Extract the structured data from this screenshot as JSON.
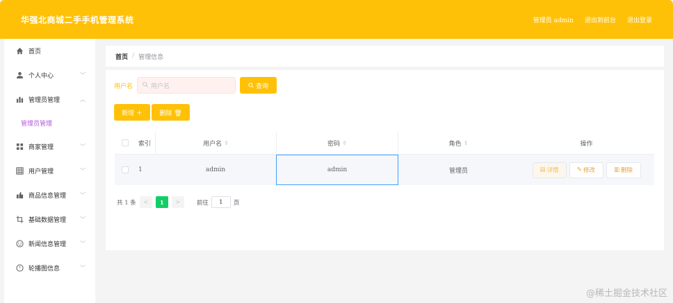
{
  "header": {
    "title": "华强北商城二手手机管理系统",
    "admin_label": "管理员 admin",
    "back_label": "退出到前台",
    "logout_label": "退出登录",
    "bg_color": "#ffc107"
  },
  "sidebar": {
    "items": [
      {
        "label": "首页",
        "icon": "home-icon"
      },
      {
        "label": "个人中心",
        "icon": "user-icon"
      },
      {
        "label": "管理员管理",
        "icon": "chart-icon"
      },
      {
        "label": "商家管理",
        "icon": "grid-icon"
      },
      {
        "label": "用户管理",
        "icon": "table-icon"
      },
      {
        "label": "商品信息管理",
        "icon": "goods-icon"
      },
      {
        "label": "基础数据管理",
        "icon": "crop-icon"
      },
      {
        "label": "新闻信息管理",
        "icon": "news-icon"
      },
      {
        "label": "轮播图信息",
        "icon": "carousel-icon"
      }
    ],
    "sub_item": "管理员管理",
    "sub_color": "#b15ad6"
  },
  "breadcrumb": {
    "home": "首页",
    "separator": "/",
    "current": "管理信息"
  },
  "search": {
    "label": "用户名",
    "placeholder": "用户名",
    "query_label": "查询"
  },
  "actions": {
    "add_label": "新增 ＋",
    "delete_label": "删除 🗑"
  },
  "table": {
    "headers": {
      "index": "索引",
      "username": "用户名",
      "password": "密码",
      "role": "角色",
      "operation": "操作"
    },
    "rows": [
      {
        "index": "1",
        "username": "admin",
        "password": "admin",
        "role": "管理员"
      }
    ],
    "op_detail": "详情",
    "op_edit": "修改",
    "op_delete": "删除"
  },
  "pager": {
    "total": "共 1 条",
    "prev": "<",
    "current": "1",
    "next": ">",
    "goto_label": "前往",
    "goto_value": "1",
    "page_suffix": "页",
    "current_color": "#13ce66"
  },
  "watermark": "@稀土掘金技术社区"
}
